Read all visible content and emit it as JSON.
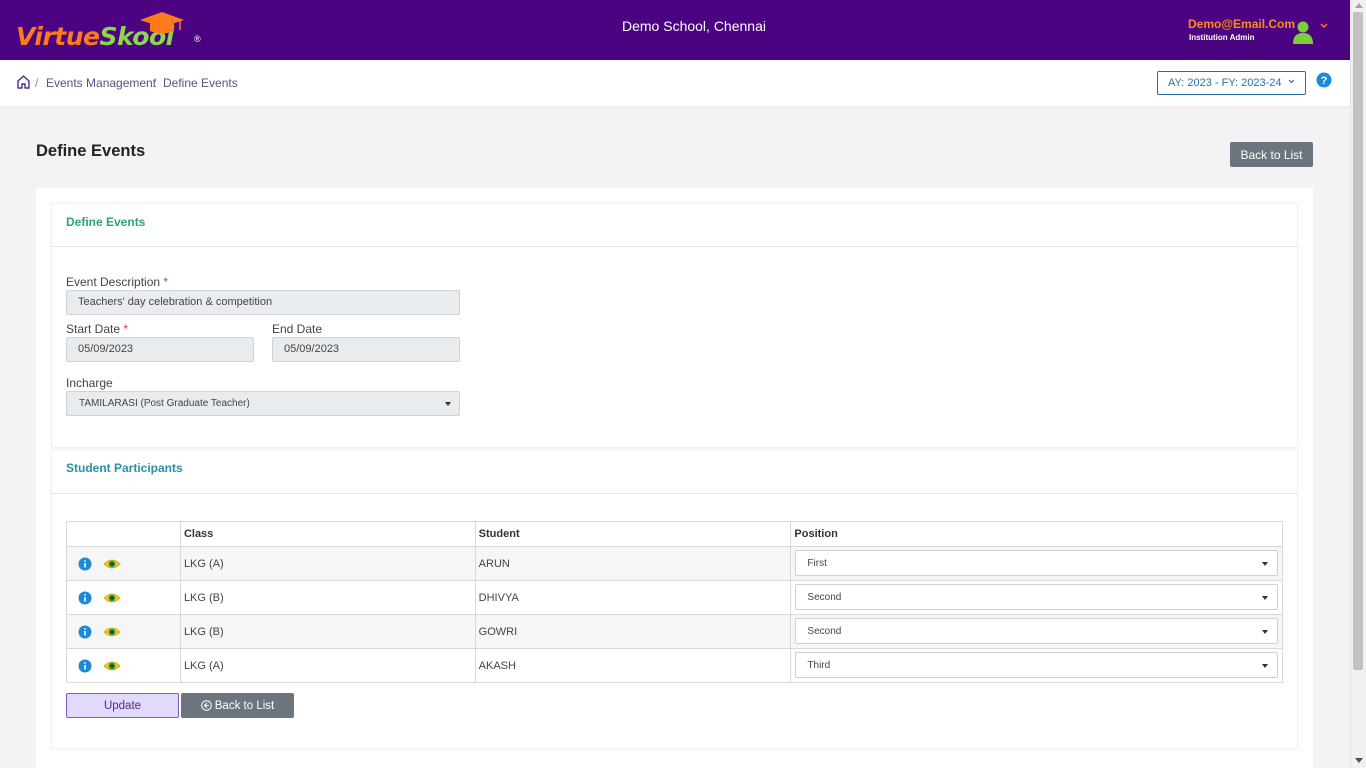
{
  "header": {
    "logo_text_a": "Virtue",
    "logo_text_b": "Sk",
    "logo_text_c": "o",
    "logo_text_d": "ol",
    "logo_reg": "®",
    "school_name": "Demo School, Chennai",
    "user_email": "Demo@Email.Com",
    "user_role": "Institution Admin"
  },
  "breadcrumb": {
    "sep": "/",
    "items": [
      "Events Management",
      "Define Events"
    ]
  },
  "year_selector": {
    "value": "AY: 2023 - FY: 2023-24"
  },
  "page": {
    "title": "Define Events",
    "back_label": "Back to List"
  },
  "event_form": {
    "section_title": "Define Events",
    "description_label": "Event Description",
    "description_value": "Teachers' day celebration & competition",
    "start_label": "Start Date",
    "start_value": "05/09/2023",
    "end_label": "End Date",
    "end_value": "05/09/2023",
    "incharge_label": "Incharge",
    "incharge_value": "TAMILARASI (Post Graduate Teacher)",
    "required_mark": "*"
  },
  "participants": {
    "section_title": "Student Participants",
    "columns": [
      "",
      "Class",
      "Student",
      "Position"
    ],
    "rows": [
      {
        "class": "LKG (A)",
        "student": "ARUN",
        "position": "First"
      },
      {
        "class": "LKG (B)",
        "student": "DHIVYA",
        "position": "Second"
      },
      {
        "class": "LKG (B)",
        "student": "GOWRI",
        "position": "Second"
      },
      {
        "class": "LKG (A)",
        "student": "AKASH",
        "position": "Third"
      }
    ]
  },
  "actions": {
    "update_label": "Update",
    "back_label": "Back to List"
  },
  "colors": {
    "topbar": "#4b0382",
    "accent_orange": "#ff7a1a",
    "accent_green": "#8bd64a",
    "section_green": "#2fa37a",
    "section_teal": "#2a8fa8",
    "info_blue": "#1c8ad8"
  },
  "icons": [
    "graduation-cap-icon",
    "user-avatar-icon",
    "chevron-down-icon",
    "home-icon",
    "help-icon",
    "info-icon",
    "eye-icon",
    "back-circle-icon"
  ]
}
